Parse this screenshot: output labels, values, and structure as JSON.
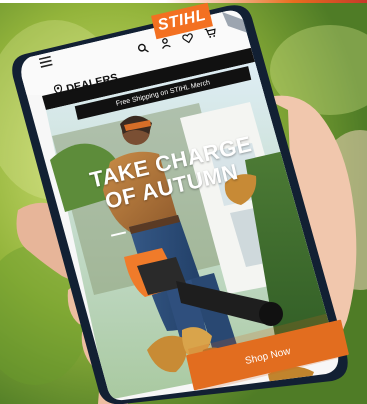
{
  "brand": {
    "logo_text": "STIHL",
    "accent_color": "#f37021"
  },
  "header": {
    "menu_icon": "menu-icon",
    "icons": [
      "search-icon",
      "account-icon",
      "heart-icon",
      "cart-icon"
    ]
  },
  "dealers": {
    "label": "DEALERS",
    "icon": "location-pin-icon"
  },
  "promo_bar": {
    "text": "Free Shipping on STIHL Merch"
  },
  "hero": {
    "title_line1": "TAKE CHARGE",
    "title_line2": "OF AUTUMN",
    "cta_label": "Shop Now"
  }
}
